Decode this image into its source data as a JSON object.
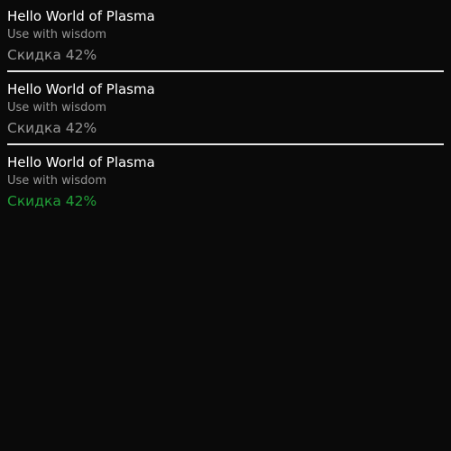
{
  "cells": [
    {
      "title": "Hello World of Plasma",
      "subtitle": "Use with wisdom",
      "label": "Скидка 42%"
    },
    {
      "title": "Hello World of Plasma",
      "subtitle": "Use with wisdom",
      "label": "Скидка 42%"
    },
    {
      "title": "Hello World of Plasma",
      "subtitle": "Use with wisdom",
      "label": "Скидка 42%"
    }
  ],
  "colors": {
    "background": "#0a0a0a",
    "title": "#ffffff",
    "secondary": "rgba(255,255,255,0.56)",
    "accent": "#21a038",
    "divider": "#e6e6e6"
  }
}
